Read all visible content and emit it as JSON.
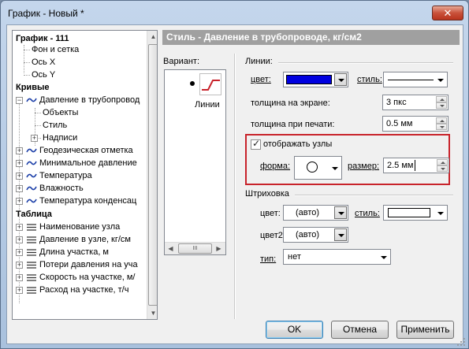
{
  "window": {
    "title": "График - Новый *",
    "close_glyph": "✕"
  },
  "tree": {
    "root": "График - 111",
    "root_children": [
      "Фон и сетка",
      "Ось X",
      "Ось Y"
    ],
    "curves_header": "Кривые",
    "curve_expanded": "Давление в трубопровод",
    "curve_children": [
      "Объекты",
      "Стиль",
      "Надписи"
    ],
    "curves": [
      "Геодезическая отметка",
      "Минимальное давление",
      "Температура",
      "Влажность",
      "Температура конденсац"
    ],
    "table_header": "Таблица",
    "table_items": [
      "Наименование узла",
      "Давление в узле, кг/см",
      "Длина участка, м",
      "Потери давления на уча",
      "Скорость на участке, м/",
      "Расход на участке, т/ч"
    ]
  },
  "panel": {
    "header": "Стиль - Давление в трубопроводе, кг/см2",
    "variant_label": "Вариант:",
    "variant_item_label": "Линии",
    "variant_scroll_thumb": "III",
    "lines_group": "Линии:",
    "color_label": "цвет:",
    "color_value": "#0000e0",
    "style_label": "стиль:",
    "screen_width_label": "толщина на экране:",
    "screen_width_value": "3 пкс",
    "print_width_label": "толщина при печати:",
    "print_width_value": "0.5 мм",
    "show_nodes_label": "отображать узлы",
    "shape_label": "форма:",
    "size_label": "размер:",
    "size_value": "2.5 мм",
    "hatch_group": "Штриховка",
    "hatch_color_label": "цвет:",
    "hatch_color_value": "(авто)",
    "hatch_style_label": "стиль:",
    "hatch_color2_label": "цвет2:",
    "hatch_color2_value": "(авто)",
    "type_label": "тип:",
    "type_value": "нет"
  },
  "buttons": {
    "ok": "OK",
    "cancel": "Отмена",
    "apply": "Применить"
  },
  "colors": {
    "accent_frame": "#c8232b",
    "header_bar": "#a0a0a0",
    "line_color": "#0000e0"
  }
}
